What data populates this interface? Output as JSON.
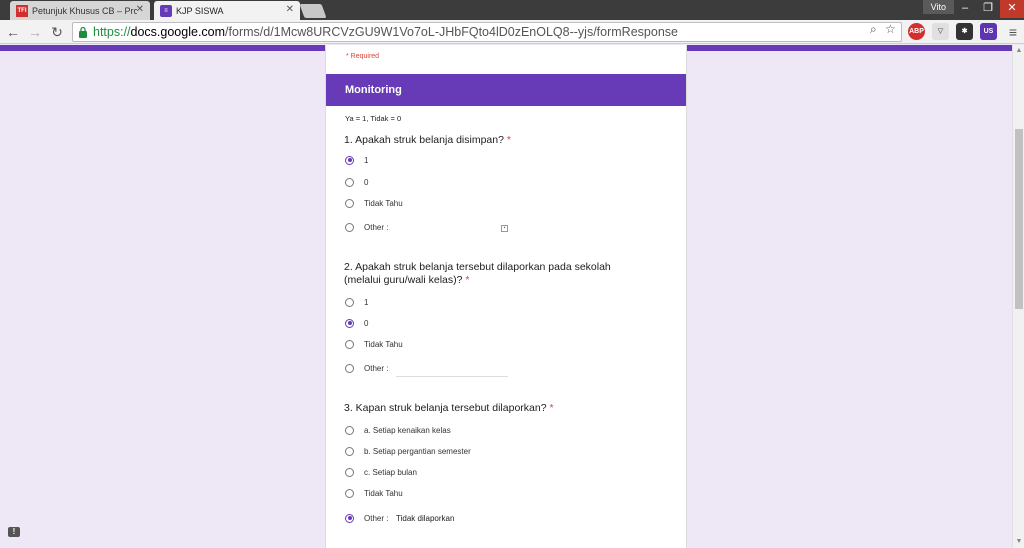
{
  "browser": {
    "tabs": [
      {
        "title": "Petunjuk Khusus CB – Pro",
        "favicon": "TFI",
        "favicon_color": "#d32f2f"
      },
      {
        "title": "KJP SISWA",
        "favicon": "forms-icon",
        "favicon_color": "#673ab7"
      }
    ],
    "profile_name": "Vito",
    "url": {
      "scheme": "https://",
      "host": "docs.google.com",
      "path": "/forms/d/1Mcw8URCVzGU9W1Vo7oL-JHbFQto4lD0zEnOLQ8--yjs/formResponse"
    },
    "extensions": [
      {
        "label": "ABP",
        "color": "#d32f2f"
      },
      {
        "label": "",
        "color": "#9e9e9e"
      },
      {
        "label": "",
        "color": "#333333"
      },
      {
        "label": "US",
        "color": "#5e35b1"
      }
    ]
  },
  "form": {
    "accent_color": "#673ab7",
    "required_note": "* Required",
    "section_title": "Monitoring",
    "section_description": "Ya = 1, Tidak = 0",
    "questions": [
      {
        "title": "1. Apakah struk belanja disimpan?",
        "required_mark": "*",
        "options": [
          {
            "label": "1",
            "checked": true
          },
          {
            "label": "0",
            "checked": false
          },
          {
            "label": "Tidak Tahu",
            "checked": false
          },
          {
            "label": "Other :",
            "checked": false,
            "other_value": ""
          }
        ]
      },
      {
        "title": "2. Apakah struk belanja tersebut dilaporkan pada sekolah (melalui guru/wali kelas)?",
        "required_mark": "*",
        "options": [
          {
            "label": "1",
            "checked": false
          },
          {
            "label": "0",
            "checked": true
          },
          {
            "label": "Tidak Tahu",
            "checked": false
          },
          {
            "label": "Other :",
            "checked": false,
            "other_value": ""
          }
        ]
      },
      {
        "title": "3. Kapan struk belanja tersebut dilaporkan?",
        "required_mark": "*",
        "options": [
          {
            "label": "a. Setiap kenaikan kelas",
            "checked": false
          },
          {
            "label": "b. Setiap pergantian semester",
            "checked": false
          },
          {
            "label": "c. Setiap bulan",
            "checked": false
          },
          {
            "label": "Tidak Tahu",
            "checked": false
          },
          {
            "label": "Other :",
            "checked": true,
            "other_value": "Tidak dilaporkan"
          }
        ]
      }
    ]
  }
}
